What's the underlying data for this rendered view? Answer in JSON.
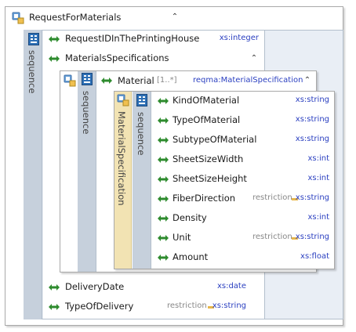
{
  "root": {
    "name": "RequestForMaterials",
    "sequence_label": "sequence",
    "children": [
      {
        "name": "RequestIDInThePrintingHouse",
        "type": "xs:integer"
      },
      {
        "name": "MaterialsSpecifications",
        "type": ""
      },
      {
        "name": "DeliveryDate",
        "type": "xs:date"
      },
      {
        "name": "TypeOfDelivery",
        "restriction": "restriction",
        "type": "xs:string"
      }
    ]
  },
  "material": {
    "name": "Material",
    "occurs": "[1..*]",
    "type": "reqma:MaterialSpecification",
    "sequence_label": "sequence",
    "complex_type_label": "MaterialSpecification",
    "inner_sequence_label": "sequence",
    "fields": [
      {
        "name": "KindOfMaterial",
        "restriction": "",
        "type": "xs:string"
      },
      {
        "name": "TypeOfMaterial",
        "restriction": "",
        "type": "xs:string"
      },
      {
        "name": "SubtypeOfMaterial",
        "restriction": "",
        "type": "xs:string"
      },
      {
        "name": "SheetSizeWidth",
        "restriction": "",
        "type": "xs:int"
      },
      {
        "name": "SheetSizeHeight",
        "restriction": "",
        "type": "xs:int"
      },
      {
        "name": "FiberDirection",
        "restriction": "restriction",
        "type": "xs:string"
      },
      {
        "name": "Density",
        "restriction": "",
        "type": "xs:int"
      },
      {
        "name": "Unit",
        "restriction": "restriction",
        "type": "xs:string"
      },
      {
        "name": "Amount",
        "restriction": "",
        "type": "xs:float"
      }
    ]
  },
  "icons": {
    "element": "element-diamond-icon",
    "sequence": "sequence-compositor-icon",
    "complex_type": "complex-type-icon",
    "collapse": "collapse-chevron-icon"
  },
  "colors": {
    "element_icon": "#2e8b2e",
    "type_text": "#2a3fc0",
    "sequence_strip": "#c6d0dc",
    "complex_strip": "#f2e3b3",
    "restriction_arrow": "#e8b74a"
  }
}
